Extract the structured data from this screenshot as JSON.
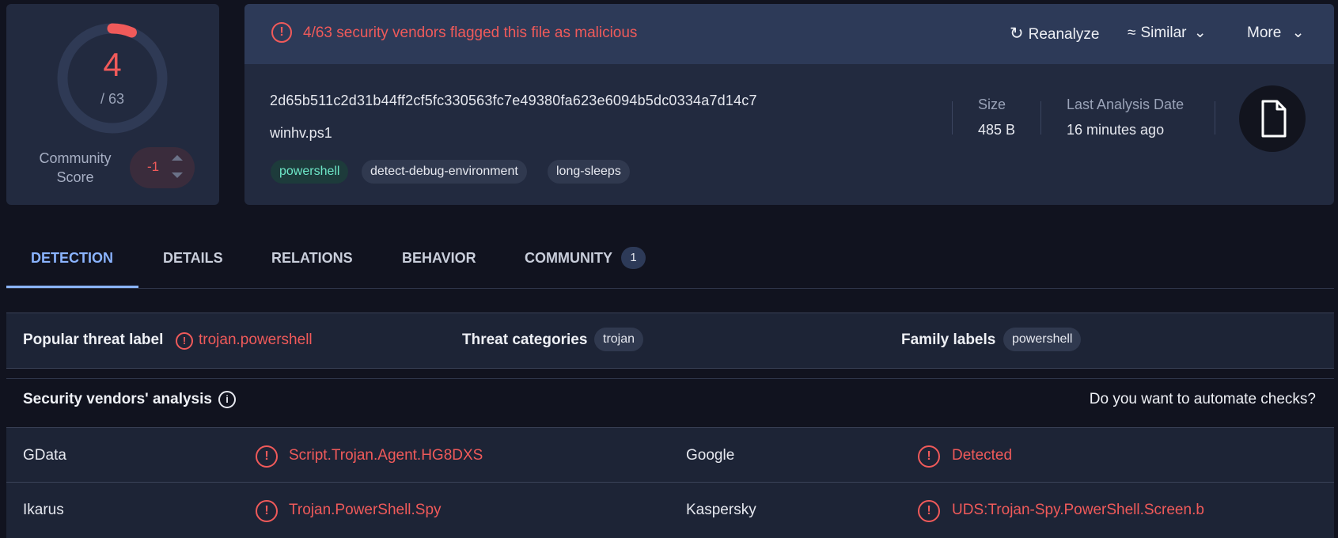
{
  "score": {
    "detections": "4",
    "total": "/ 63",
    "detections_fraction": 0.0635,
    "community_label_line1": "Community",
    "community_label_line2": "Score",
    "community_value": "-1"
  },
  "file": {
    "alert": "4/63 security vendors flagged this file as malicious",
    "actions": {
      "reanalyze": "Reanalyze",
      "similar": "Similar",
      "more": "More"
    },
    "hash": "2d65b511c2d31b44ff2cf5fc330563fc7e49380fa623e6094b5dc0334a7d14c7",
    "name": "winhv.ps1",
    "tags": [
      "powershell",
      "detect-debug-environment",
      "long-sleeps"
    ],
    "size_label": "Size",
    "size_value": "485 B",
    "date_label": "Last Analysis Date",
    "date_value": "16 minutes ago"
  },
  "tabs": [
    {
      "label": "DETECTION"
    },
    {
      "label": "DETAILS"
    },
    {
      "label": "RELATIONS"
    },
    {
      "label": "BEHAVIOR"
    },
    {
      "label": "COMMUNITY",
      "badge": "1"
    }
  ],
  "labels": {
    "popular_title": "Popular threat label",
    "popular_value": "trojan.powershell",
    "categories_title": "Threat categories",
    "categories_value": "trojan",
    "family_title": "Family labels",
    "family_value": "powershell"
  },
  "vendors_section": {
    "title": "Security vendors' analysis",
    "automate": "Do you want to automate checks?"
  },
  "vendors": [
    {
      "name": "GData",
      "result": "Script.Trojan.Agent.HG8DXS"
    },
    {
      "name": "Google",
      "result": "Detected"
    },
    {
      "name": "Ikarus",
      "result": "Trojan.PowerShell.Spy"
    },
    {
      "name": "Kaspersky",
      "result": "UDS:Trojan-Spy.PowerShell.Screen.b"
    }
  ],
  "colors": {
    "background": "#11131f",
    "card": "#222a3f",
    "header": "#2d3a58",
    "malicious": "#f05a5a",
    "accent": "#8bb4ff",
    "tag_green": "#6ee7c8"
  }
}
